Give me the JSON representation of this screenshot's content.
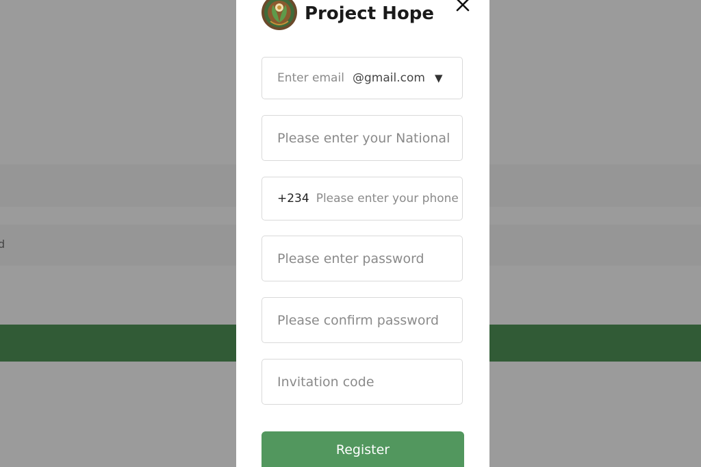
{
  "background": {
    "fragment_text": "d",
    "accent_green": "#315b36"
  },
  "modal": {
    "logo_icon": "project-hope-logo",
    "title": "Project Hope",
    "close_icon": "close-icon"
  },
  "form": {
    "email": {
      "placeholder": "Enter email",
      "domain": "@gmail.com",
      "caret": "▼"
    },
    "national_id": {
      "placeholder": "Please enter your National"
    },
    "phone": {
      "prefix": "+234",
      "placeholder": "Please enter your phone"
    },
    "password": {
      "placeholder": "Please enter password"
    },
    "confirm_password": {
      "placeholder": "Please confirm password"
    },
    "invitation": {
      "placeholder": "Invitation code"
    },
    "register_label": "Register",
    "register_color": "#52975e"
  }
}
